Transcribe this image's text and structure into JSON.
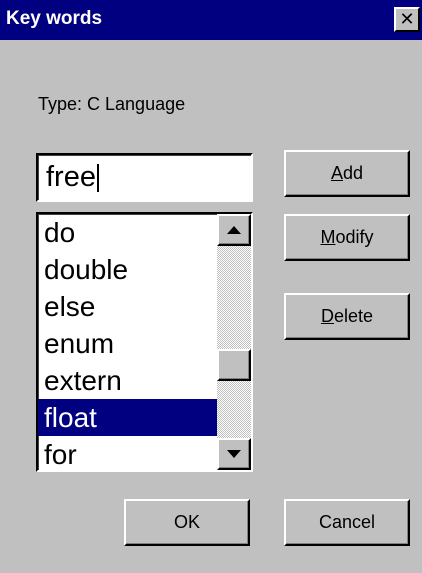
{
  "window": {
    "title": "Key words",
    "close_glyph": "✕"
  },
  "type_label": "Type: C Language",
  "word_input": {
    "value": "free"
  },
  "keyword_list": {
    "items": [
      {
        "label": "do",
        "selected": false
      },
      {
        "label": "double",
        "selected": false
      },
      {
        "label": "else",
        "selected": false
      },
      {
        "label": "enum",
        "selected": false
      },
      {
        "label": "extern",
        "selected": false
      },
      {
        "label": "float",
        "selected": true
      },
      {
        "label": "for",
        "selected": false
      }
    ]
  },
  "buttons": {
    "add": {
      "mnemonic": "A",
      "rest": "dd"
    },
    "modify": {
      "mnemonic": "M",
      "rest": "odify"
    },
    "delete": {
      "mnemonic": "D",
      "rest": "elete"
    },
    "ok": "OK",
    "cancel": "Cancel"
  },
  "colors": {
    "titlebar": "#000080",
    "face": "#c0c0c0",
    "selection": "#000080"
  },
  "icons": {
    "close": "close-icon",
    "scroll_up": "arrow-up-icon",
    "scroll_down": "arrow-down-icon"
  }
}
